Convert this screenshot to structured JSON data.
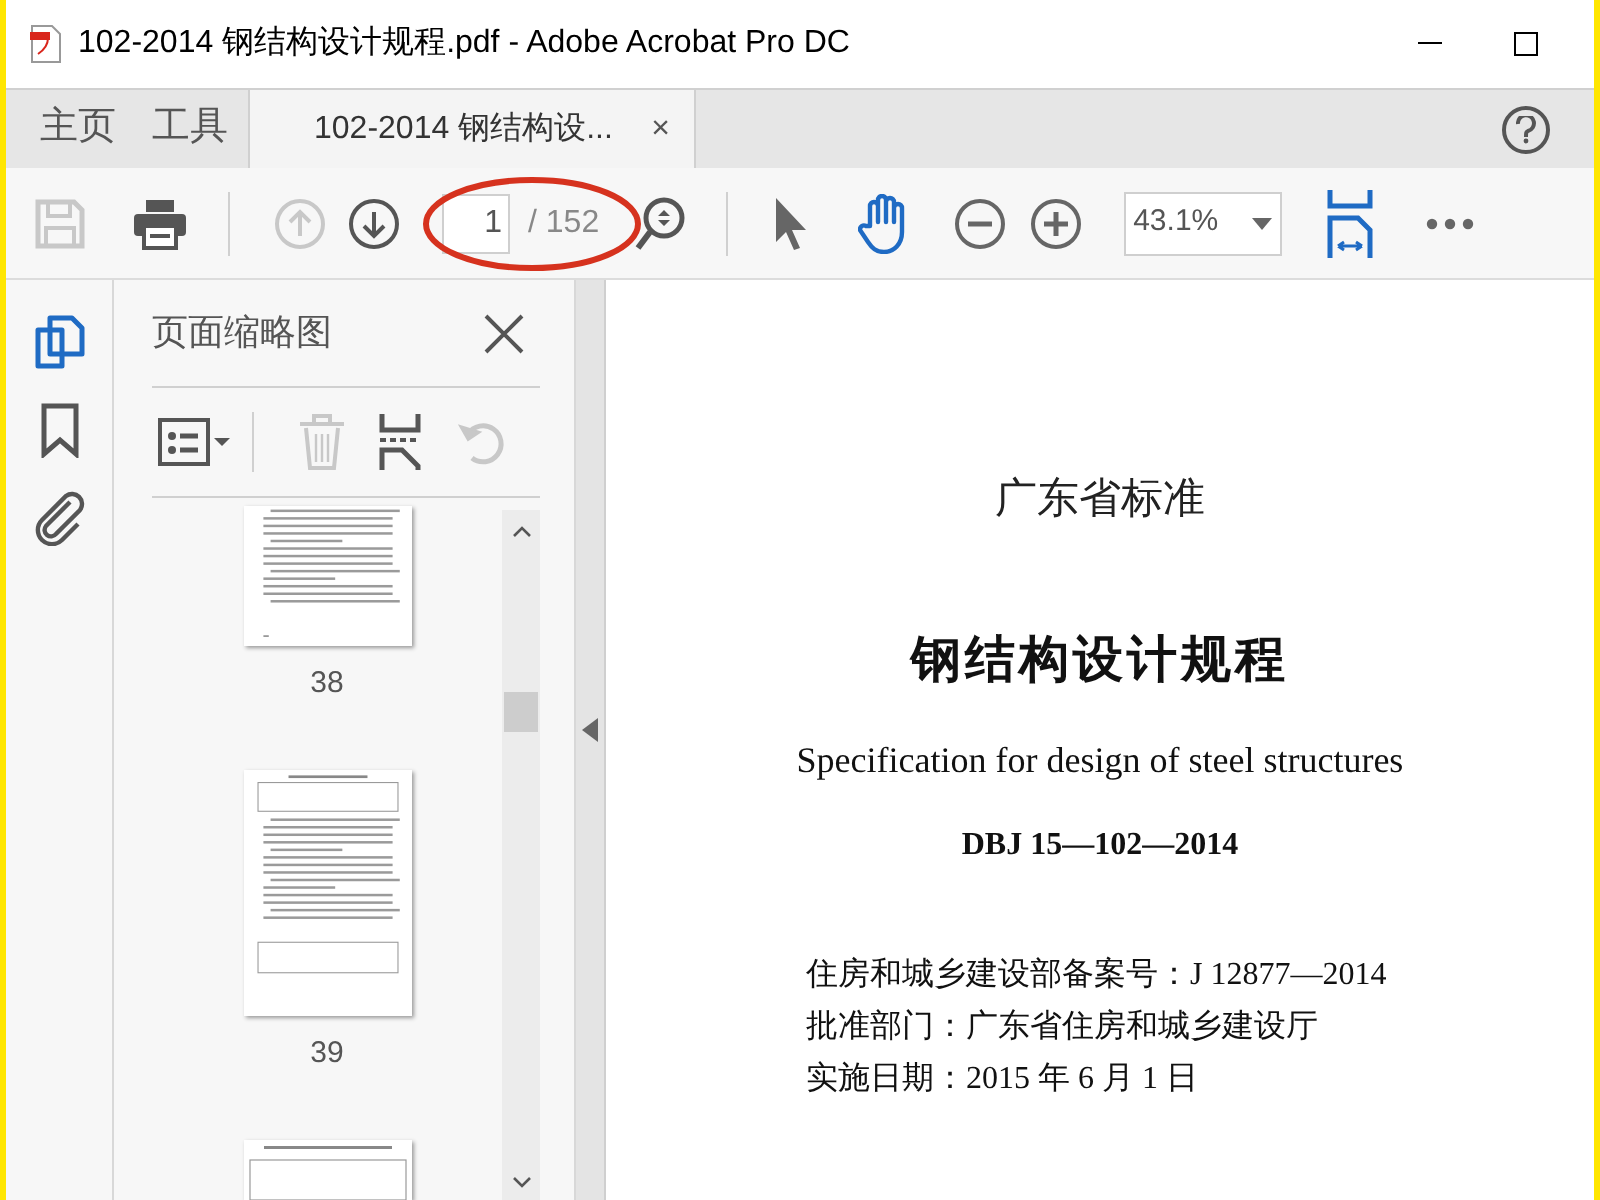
{
  "window": {
    "title": "102-2014 钢结构设计规程.pdf - Adobe Acrobat Pro DC"
  },
  "tabs": [
    {
      "label": "主页",
      "selected": false
    },
    {
      "label": "工具",
      "selected": false
    },
    {
      "label": "102-2014 钢结构设...",
      "selected": true,
      "close": "×"
    }
  ],
  "toolbar": {
    "save_disabled": true,
    "previous_disabled": true,
    "next_disabled": false,
    "page": "1",
    "page_total": "/ 152",
    "zoom": "43.1%",
    "tools": [
      {
        "kind": "select",
        "selected": false
      },
      {
        "kind": "hand",
        "selected": true
      }
    ]
  },
  "rail": [
    {
      "kind": "pages",
      "selected": true
    },
    {
      "kind": "bookmark",
      "selected": false
    },
    {
      "kind": "attachment",
      "selected": false
    }
  ],
  "panel": {
    "title": "页面缩略图",
    "delete_disabled": true,
    "rotate_disabled": true,
    "thumbnails": [
      {
        "label": "38",
        "kind": "text"
      },
      {
        "label": "39",
        "kind": "table"
      }
    ]
  },
  "document": {
    "lines": [
      {
        "kind": "heading",
        "text": "广东省标准"
      },
      {
        "kind": "title",
        "text": "钢结构设计规程"
      },
      {
        "kind": "subtitle",
        "text": "Specification for design of steel structures"
      },
      {
        "kind": "code",
        "text": "DBJ 15—102—2014"
      },
      {
        "kind": "info",
        "text": "住房和城乡建设部备案号：J 12877—2014"
      },
      {
        "kind": "info",
        "text": "批准部门：广东省住房和城乡建设厅"
      },
      {
        "kind": "info",
        "text": "实施日期：2015 年 6 月 1 日"
      }
    ]
  }
}
